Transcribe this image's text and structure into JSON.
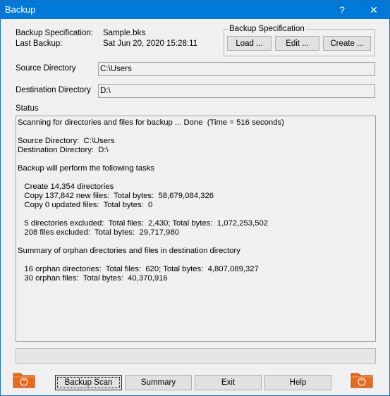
{
  "window": {
    "title": "Backup",
    "help_glyph": "?",
    "close_glyph": "✕"
  },
  "info": {
    "spec_label": "Backup Specification:",
    "spec_value": "Sample.bks",
    "last_label": "Last Backup:",
    "last_value": "Sat Jun 20, 2020 15:28:11"
  },
  "spec_group": {
    "label": "Backup Specification",
    "load": "Load ...",
    "edit": "Edit ...",
    "create": "Create ..."
  },
  "source": {
    "label": "Source Directory",
    "value": "C:\\Users"
  },
  "destination": {
    "label": "Destination Directory",
    "value": "D:\\"
  },
  "status": {
    "label": "Status",
    "lines": [
      "Scanning for directories and files for backup ... Done  (Time = 516 seconds)",
      "",
      "Source Directory:  C:\\Users",
      "Destination Directory:  D:\\",
      "",
      "Backup will perform the following tasks",
      "",
      "   Create 14,354 directories",
      "   Copy 137,842 new files:  Total bytes:  58,679,084,326",
      "   Copy 0 updated files:  Total bytes:  0",
      "",
      "   5 directories excluded:  Total files:  2,430; Total bytes:  1,072,253,502",
      "   208 files excluded:  Total bytes:  29,717,980",
      "",
      "Summary of orphan directories and files in destination directory",
      "",
      "   16 orphan directories:  Total files:  620; Total bytes:  4,807,089,327",
      "   30 orphan files:  Total bytes:  40,370,916"
    ]
  },
  "buttons": {
    "backup_scan": "Backup Scan",
    "summary": "Summary",
    "exit": "Exit",
    "help": "Help"
  },
  "colors": {
    "titlebar": "#0078d7",
    "folder": "#e86a1e"
  }
}
